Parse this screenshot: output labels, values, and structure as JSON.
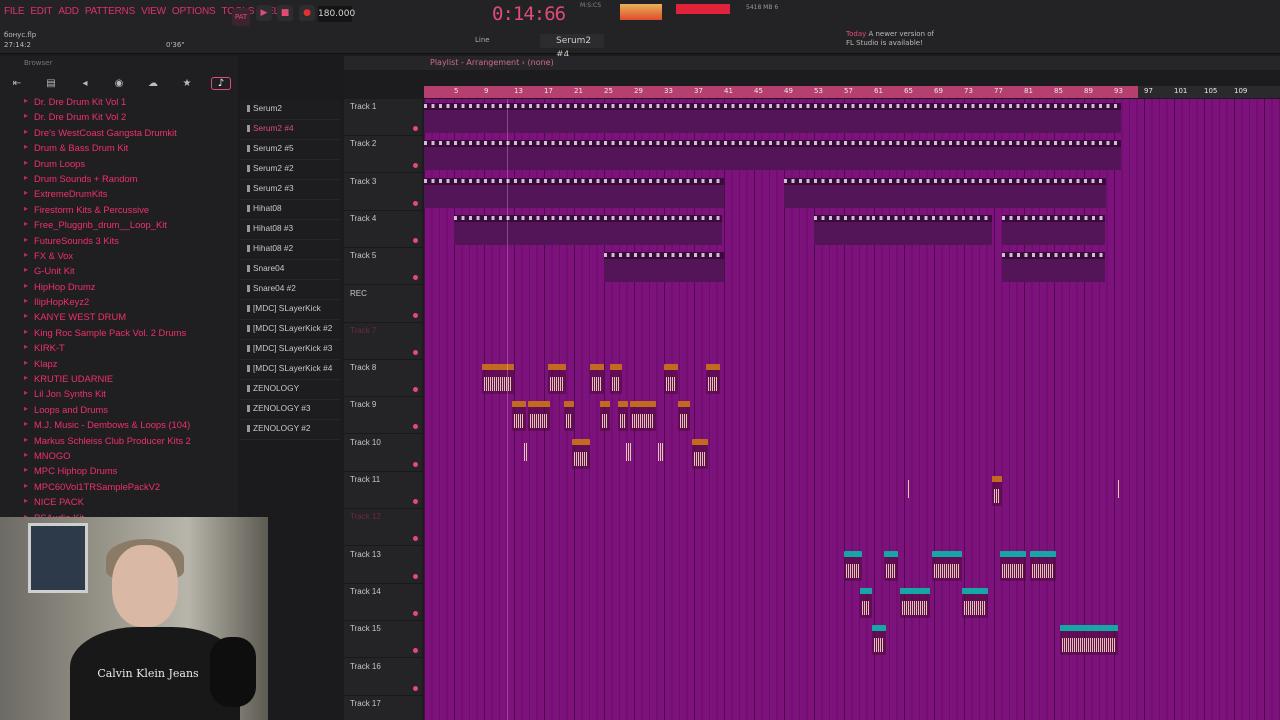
{
  "menu": [
    "FILE",
    "EDIT",
    "ADD",
    "PATTERNS",
    "VIEW",
    "OPTIONS",
    "TOOLS",
    "HELP"
  ],
  "project": {
    "name": "бонус.flp",
    "position": "27:14:2",
    "hint_time": "0'36\""
  },
  "transport": {
    "pat_label": "PAT",
    "tempo": "180.000",
    "time": "0:14:66",
    "time_unit": "M:S:CS",
    "cpu": "5418 MB\n6"
  },
  "toolbar": {
    "line_label": "Line",
    "pattern": "Serum2 #4"
  },
  "news": {
    "prefix": "Today",
    "text": "A newer version of FL Studio is available!"
  },
  "browser": {
    "title": "Browser",
    "items": [
      "Dr. Dre Drum Kit Vol 1",
      "Dr. Dre Drum Kit Vol 2",
      "Dre's WestCoast Gangsta Drumkit",
      "Drum & Bass Drum Kit",
      "Drum Loops",
      "Drum Sounds + Random",
      "ExtremeDrumKits",
      "Firestorm Kits & Percussive",
      "Free_Pluggnb_drum__Loop_Kit",
      "FutureSounds 3 Kits",
      "FX & Vox",
      "G-Unit Kit",
      "HipHop Drumz",
      "IlipHopKeyz2",
      "KANYE WEST DRUM",
      "King Roc Sample Pack Vol. 2 Drums",
      "KIRK-T",
      "Klapz",
      "KRUTIE UDARNIE",
      "Lil Jon Synths Kit",
      "Loops and Drums",
      "M.J. Music - Dembows & Loops (104)",
      "Markus Schleiss Club Producer Kits 2",
      "MNOGO",
      "MPC Hiphop Drums",
      "MPC60Vol1TRSamplePackV2",
      "NICE PACK",
      "PSAudio Kit"
    ]
  },
  "picker": {
    "items": [
      "Serum2",
      "Serum2 #4",
      "Serum2 #5",
      "Serum2 #2",
      "Serum2 #3",
      "Hihat08",
      "Hihat08 #3",
      "Hihat08 #2",
      "Snare04",
      "Snare04 #2",
      "[MDC] SLayerKick",
      "[MDC] SLayerKick #2",
      "[MDC] SLayerKick #3",
      "[MDC] SLayerKick #4",
      "ZENOLOGY",
      "ZENOLOGY #3",
      "ZENOLOGY #2"
    ],
    "selected": 1
  },
  "playlist": {
    "title": "Playlist - Arrangement › (none)",
    "ruler": [
      "5",
      "9",
      "13",
      "17",
      "21",
      "25",
      "29",
      "33",
      "37",
      "41",
      "45",
      "49",
      "53",
      "57",
      "61",
      "65",
      "69",
      "73",
      "77",
      "81",
      "85",
      "89",
      "93",
      "97",
      "101",
      "105",
      "109"
    ],
    "tracks": [
      "Track 1",
      "Track 2",
      "Track 3",
      "Track 4",
      "Track 5",
      "REC",
      "Track 7",
      "Track 8",
      "Track 9",
      "Track 10",
      "Track 11",
      "Track 12",
      "Track 13",
      "Track 14",
      "Track 15",
      "Track 16",
      "Track 17"
    ]
  },
  "webcam": {
    "shirt_text": "Calvin Klein Jeans"
  },
  "colors": {
    "accent": "#e04b77",
    "playlist_bg": "#7d127d"
  }
}
